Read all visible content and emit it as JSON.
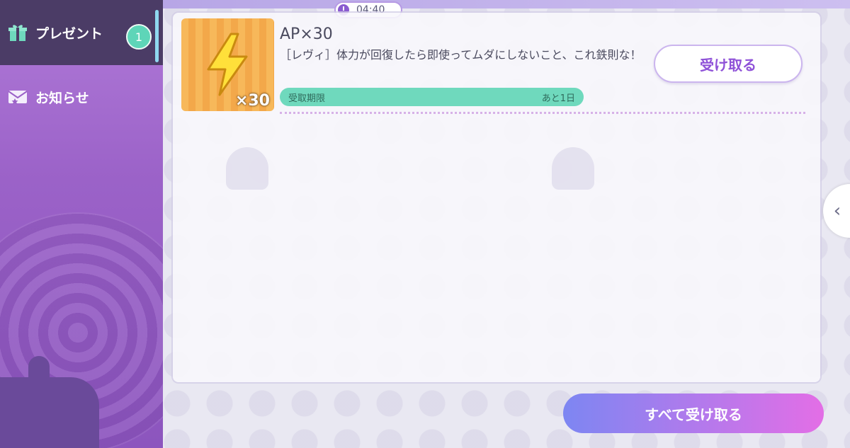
{
  "sidebar": {
    "items": [
      {
        "label": "プレゼント",
        "icon": "gift-icon",
        "badge": "1"
      },
      {
        "label": "お知らせ",
        "icon": "envelope-icon"
      }
    ]
  },
  "timer": {
    "value": "04:40",
    "icon": "clock-icon"
  },
  "present_item": {
    "title": "AP×30",
    "description": "［レヴィ］体力が回復したら即使ってムダにしないこと、これ鉄則な！",
    "quantity": "×30",
    "icon": "lightning-bolt-icon",
    "deadline_label": "受取期限",
    "deadline_value": "あと1日",
    "receive_label": "受け取る"
  },
  "footer": {
    "receive_all_label": "すべて受け取る"
  },
  "side_tab": {
    "icon": "chevron-left-icon",
    "glyph": "‹"
  },
  "colors": {
    "accent": "#8f52d8",
    "badge": "#5ed5b8",
    "deadline_bar": "#6fd9bd"
  }
}
